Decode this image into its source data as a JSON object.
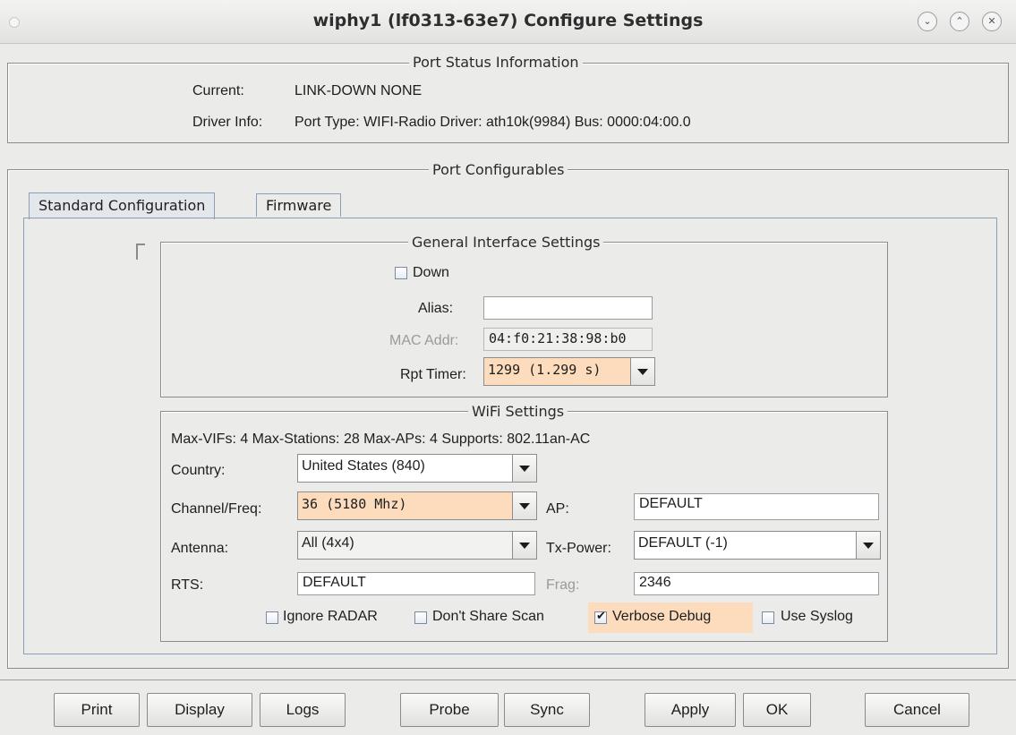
{
  "window": {
    "title": "wiphy1  (lf0313-63e7) Configure Settings",
    "controls": [
      "minimize-icon",
      "maximize-icon",
      "close-icon"
    ]
  },
  "port_status": {
    "legend": "Port Status Information",
    "current_label": "Current:",
    "current_value": "LINK-DOWN  NONE",
    "driver_label": "Driver Info:",
    "driver_value": "Port Type: WIFI-Radio   Driver: ath10k(9984)  Bus: 0000:04:00.0"
  },
  "configurables": {
    "legend": "Port Configurables",
    "tabs": [
      {
        "label": "Standard Configuration",
        "selected": true
      },
      {
        "label": "Firmware",
        "selected": false
      }
    ]
  },
  "general": {
    "legend": "General Interface Settings",
    "down_label": "Down",
    "down_checked": false,
    "alias_label": "Alias:",
    "alias_value": "",
    "mac_label": "MAC Addr:",
    "mac_value": "04:f0:21:38:98:b0",
    "rpt_label": "Rpt Timer:",
    "rpt_value": "1299 (1.299 s)"
  },
  "wifi": {
    "legend": "WiFi Settings",
    "summary": "Max-VIFs: 4  Max-Stations: 28  Max-APs: 4  Supports: 802.11an-AC",
    "country_label": "Country:",
    "country_value": "United States (840)",
    "channel_label": "Channel/Freq:",
    "channel_value": "36 (5180 Mhz)",
    "ap_label": "AP:",
    "ap_value": "DEFAULT",
    "antenna_label": "Antenna:",
    "antenna_value": "All (4x4)",
    "txpower_label": "Tx-Power:",
    "txpower_value": "DEFAULT  (-1)",
    "rts_label": "RTS:",
    "rts_value": "DEFAULT",
    "frag_label": "Frag:",
    "frag_value": "2346",
    "options": [
      {
        "label": "Ignore RADAR",
        "checked": false
      },
      {
        "label": "Don't Share Scan",
        "checked": false
      },
      {
        "label": "Verbose Debug",
        "checked": true
      },
      {
        "label": "Use Syslog",
        "checked": false
      }
    ]
  },
  "buttons": {
    "print": "Print",
    "display": "Display",
    "logs": "Logs",
    "probe": "Probe",
    "sync": "Sync",
    "apply": "Apply",
    "ok": "OK",
    "cancel": "Cancel"
  },
  "colors": {
    "modified_highlight": "#fcdcbc",
    "panel_border": "#8c8c8c",
    "tab_border": "#8c9fba"
  }
}
